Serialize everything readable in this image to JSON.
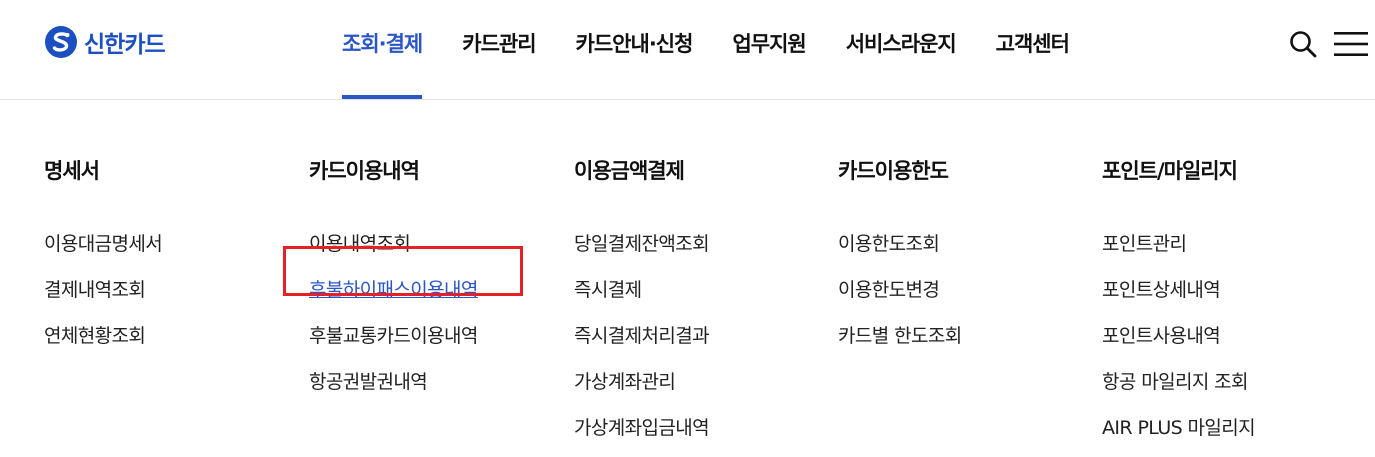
{
  "brand": {
    "name": "신한카드",
    "color": "#1c4fbf"
  },
  "gnb": {
    "items": [
      {
        "label": "조회·결제",
        "active": true
      },
      {
        "label": "카드관리",
        "active": false
      },
      {
        "label": "카드안내·신청",
        "active": false
      },
      {
        "label": "업무지원",
        "active": false
      },
      {
        "label": "서비스라운지",
        "active": false
      },
      {
        "label": "고객센터",
        "active": false
      }
    ],
    "active_color": "#2a56c6"
  },
  "utility": {
    "search_icon": "search-icon",
    "menu_icon": "hamburger-menu-icon"
  },
  "mega_menu": {
    "columns": [
      {
        "title": "명세서",
        "items": [
          "이용대금명세서",
          "결제내역조회",
          "연체현황조회"
        ]
      },
      {
        "title": "카드이용내역",
        "items": [
          "이용내역조회",
          "후불하이패스이용내역",
          "후불교통카드이용내역",
          "항공권발권내역"
        ]
      },
      {
        "title": "이용금액결제",
        "items": [
          "당일결제잔액조회",
          "즉시결제",
          "즉시결제처리결과",
          "가상계좌관리",
          "가상계좌입금내역"
        ]
      },
      {
        "title": "카드이용한도",
        "items": [
          "이용한도조회",
          "이용한도변경",
          "카드별 한도조회"
        ]
      },
      {
        "title": "포인트/마일리지",
        "items": [
          "포인트관리",
          "포인트상세내역",
          "포인트사용내역",
          "항공 마일리지 조회",
          "AIR PLUS 마일리지"
        ]
      }
    ],
    "highlighted_item": "후불하이패스이용내역",
    "highlight_color": "#e52027"
  }
}
